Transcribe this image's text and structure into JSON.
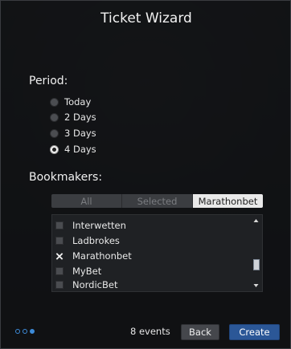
{
  "window": {
    "title": "Ticket Wizard"
  },
  "period": {
    "label": "Period:",
    "options": [
      {
        "label": "Today",
        "selected": false
      },
      {
        "label": "2 Days",
        "selected": false
      },
      {
        "label": "3 Days",
        "selected": false
      },
      {
        "label": "4 Days",
        "selected": true
      }
    ]
  },
  "bookmakers": {
    "label": "Bookmakers:",
    "tabs": [
      {
        "label": "All",
        "active": false
      },
      {
        "label": "Selected",
        "active": false
      },
      {
        "label": "Marathonbet",
        "active": true
      }
    ],
    "items": [
      {
        "label": "Interwetten",
        "checked": false
      },
      {
        "label": "Ladbrokes",
        "checked": false
      },
      {
        "label": "Marathonbet",
        "checked": true
      },
      {
        "label": "MyBet",
        "checked": false
      },
      {
        "label": "NordicBet",
        "checked": false
      }
    ]
  },
  "footer": {
    "steps_total": 3,
    "step_current": 3,
    "events_text": "8 events",
    "back_label": "Back",
    "create_label": "Create"
  },
  "colors": {
    "accent": "#3d8bd9",
    "primary_button": "#2b5797",
    "background": "#121416"
  }
}
